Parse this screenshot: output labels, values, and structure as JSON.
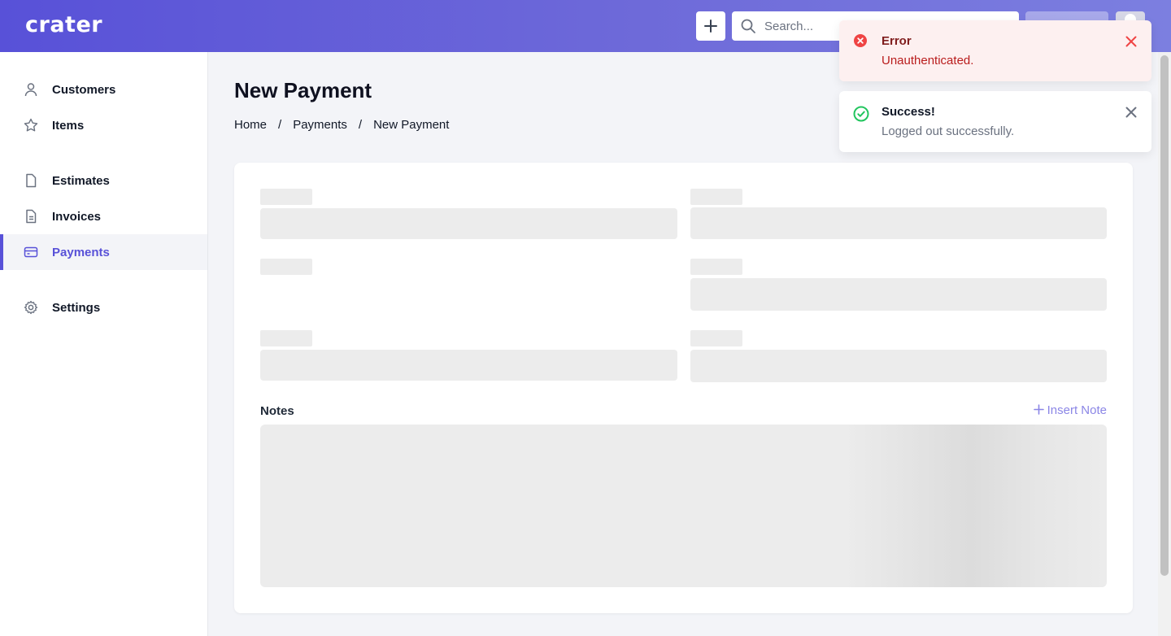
{
  "header": {
    "logo": "crater",
    "search_placeholder": "Search..."
  },
  "sidebar": {
    "items": [
      {
        "label": "Customers",
        "icon": "user-icon"
      },
      {
        "label": "Items",
        "icon": "star-icon"
      },
      {
        "label": "Estimates",
        "icon": "document-icon"
      },
      {
        "label": "Invoices",
        "icon": "document-text-icon"
      },
      {
        "label": "Payments",
        "icon": "credit-card-icon",
        "active": true
      },
      {
        "label": "Settings",
        "icon": "gear-icon"
      }
    ]
  },
  "page": {
    "title": "New Payment",
    "breadcrumb": [
      "Home",
      "Payments",
      "New Payment"
    ],
    "separator": "/"
  },
  "form": {
    "notes_label": "Notes",
    "insert_note_label": "Insert Note"
  },
  "toasts": [
    {
      "type": "error",
      "title": "Error",
      "message": "Unauthenticated."
    },
    {
      "type": "success",
      "title": "Success!",
      "message": "Logged out successfully."
    }
  ],
  "colors": {
    "primary": "#5851d8",
    "error": "#ef4444",
    "success": "#22c55e"
  }
}
